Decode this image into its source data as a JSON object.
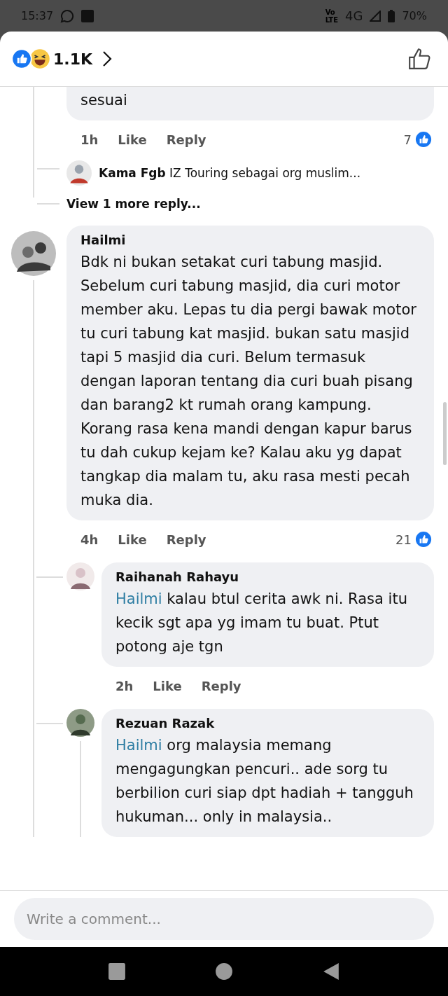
{
  "status_bar": {
    "time": "15:37",
    "volte": [
      "Vo",
      "LTE"
    ],
    "network": "4G",
    "battery": "70%"
  },
  "header": {
    "reaction_count": "1.1K"
  },
  "previous_comment": {
    "text": "sesuai",
    "time": "1h",
    "like": "Like",
    "reply": "Reply",
    "reaction_count": "7",
    "reply_preview": {
      "author": "Kama Fgb",
      "text": "IZ Touring sebagai org muslim..."
    },
    "more_replies": "View 1 more reply..."
  },
  "comment": {
    "author": "Hailmi",
    "text": "Bdk ni bukan setakat curi tabung masjid.  Sebelum curi tabung masjid, dia curi motor member aku. Lepas tu dia pergi bawak motor tu curi tabung kat masjid. bukan satu masjid tapi 5 masjid dia curi.  Belum termasuk dengan laporan tentang dia curi buah pisang dan barang2 kt rumah orang kampung.  Korang rasa kena mandi dengan kapur barus tu dah cukup kejam ke?  Kalau aku yg dapat tangkap dia malam tu, aku rasa mesti pecah muka dia.",
    "time": "4h",
    "like": "Like",
    "reply": "Reply",
    "reaction_count": "21",
    "replies": [
      {
        "author": "Raihanah Rahayu",
        "mention": "Hailmi",
        "text": "kalau btul cerita awk ni. Rasa itu kecik sgt apa yg imam tu buat.  Ptut potong aje tgn",
        "time": "2h",
        "like": "Like",
        "reply": "Reply"
      },
      {
        "author": "Rezuan Razak",
        "mention": "Hailmi",
        "text": "org malaysia memang mengagungkan pencuri..  ade sorg tu berbilion curi siap dpt hadiah + tangguh hukuman... only in malaysia.."
      }
    ]
  },
  "composer": {
    "placeholder": "Write a comment..."
  }
}
